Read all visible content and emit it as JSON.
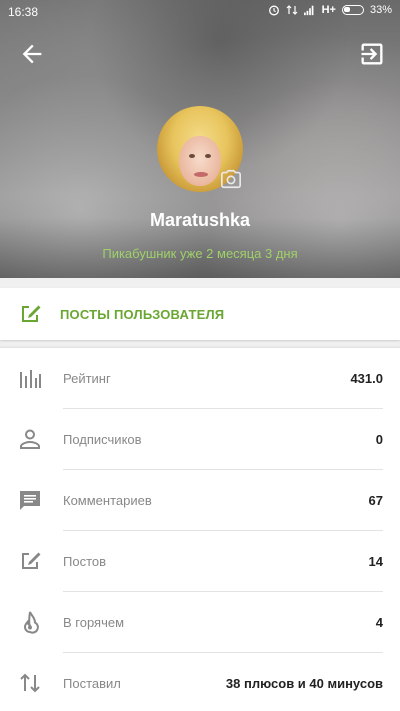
{
  "status_bar": {
    "time": "16:38",
    "network": "H+",
    "battery": "33%"
  },
  "profile": {
    "username": "Maratushka",
    "tenure": "Пикабушник уже 2 месяца 3 дня",
    "accent_green": "#6aa632",
    "tenure_green": "#9fd06a"
  },
  "posts_button": {
    "label": "ПОСТЫ ПОЛЬЗОВАТЕЛЯ",
    "icon": "edit-square-icon"
  },
  "stats": [
    {
      "icon": "bar-chart-icon",
      "label": "Рейтинг",
      "value": "431.0"
    },
    {
      "icon": "person-icon",
      "label": "Подписчиков",
      "value": "0"
    },
    {
      "icon": "comment-icon",
      "label": "Комментариев",
      "value": "67"
    },
    {
      "icon": "edit-square-icon",
      "label": "Постов",
      "value": "14"
    },
    {
      "icon": "flame-icon",
      "label": "В горячем",
      "value": "4"
    },
    {
      "icon": "swap-vertical-icon",
      "label": "Поставил",
      "value": "38 плюсов и 40 минусов"
    }
  ]
}
